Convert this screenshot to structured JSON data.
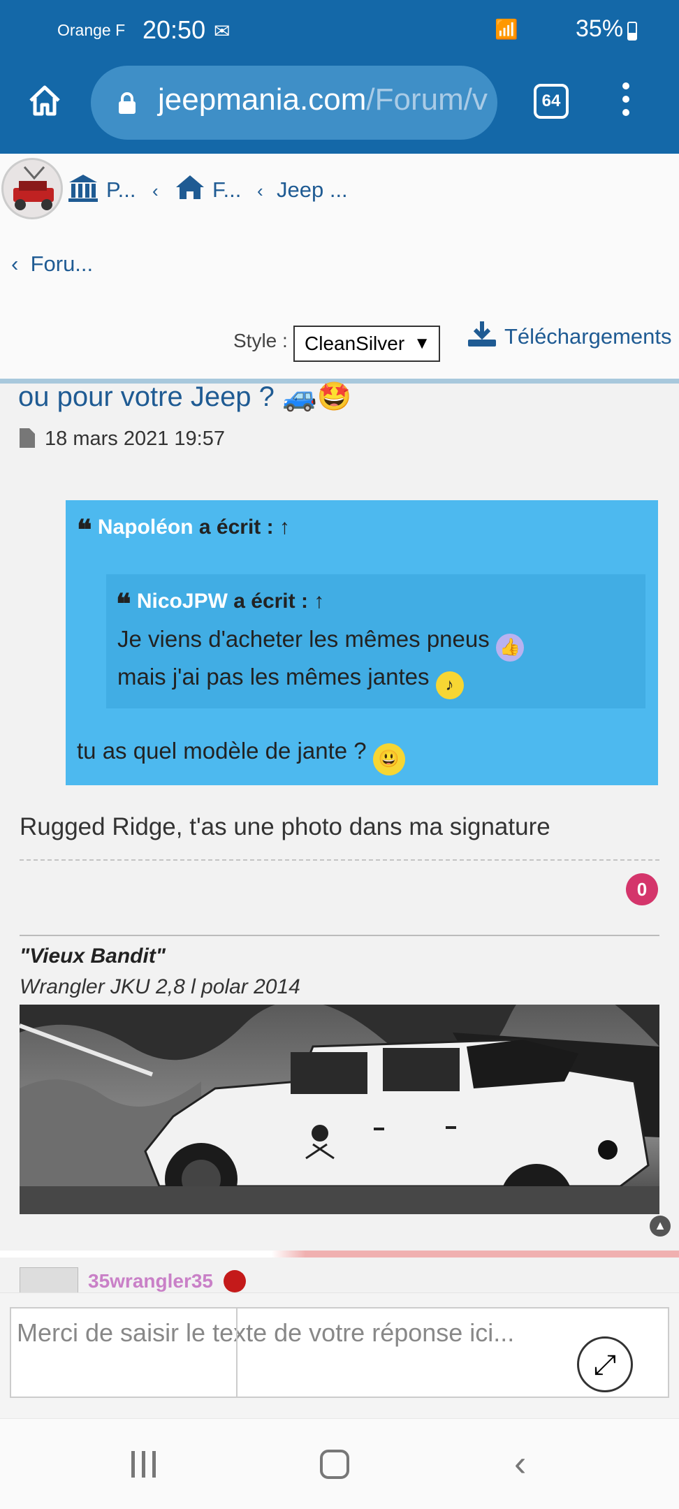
{
  "status_bar": {
    "carrier": "Orange F",
    "time": "20:50",
    "battery": "35%"
  },
  "browser": {
    "url_domain": "jeepmania.com",
    "url_path": "/Forum/v",
    "tab_count": "64"
  },
  "breadcrumbs": [
    {
      "label": "P..."
    },
    {
      "label": "F..."
    },
    {
      "label": "Jeep ..."
    }
  ],
  "forum_back": "Foru...",
  "style_label": "Style :",
  "style_value": "CleanSilver",
  "downloads_label": "Téléchargements",
  "post": {
    "title": "ou pour votre Jeep ? 🚙🤩",
    "date": "18 mars 2021 19:57",
    "quote_outer": {
      "author": "Napoléon",
      "wrote": " a écrit : ↑",
      "text": "tu as quel modèle de jante ? "
    },
    "quote_inner": {
      "author": "NicoJPW",
      "wrote": " a écrit : ↑",
      "line1": "Je viens d'acheter les mêmes pneus ",
      "line2": "mais j'ai pas les mêmes jantes "
    },
    "reply": "Rugged Ridge, t'as une photo dans ma signature",
    "likes": "0",
    "signature_line1": "\"Vieux Bandit\"",
    "signature_line2": "Wrangler JKU 2,8 l polar 2014"
  },
  "next_post": {
    "username": "35wrangler35"
  },
  "compose": {
    "placeholder": "Merci de saisir le texte de votre réponse ici..."
  },
  "colors": {
    "brand_blue": "#1468a8",
    "link_blue": "#1f5b93",
    "quote_blue": "#4db9ef",
    "badge_red": "#d4356b"
  }
}
